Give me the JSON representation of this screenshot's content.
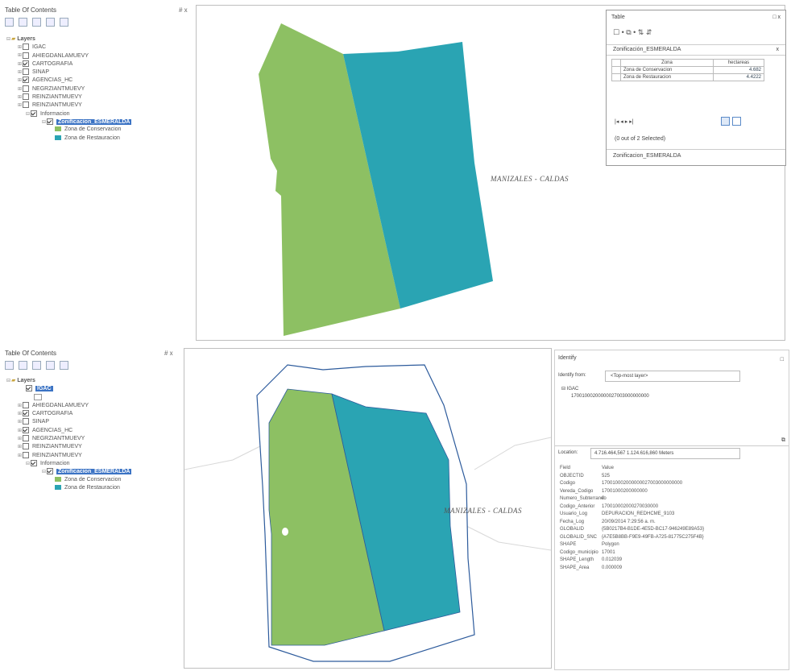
{
  "top": {
    "toc": {
      "title": "Table Of Contents",
      "pin": "# x",
      "layers_root": "Layers",
      "items": [
        {
          "label": "IGAC",
          "checked": false
        },
        {
          "label": "AHIEGDANLAMUEVY",
          "checked": false
        },
        {
          "label": "CARTOGRAFIA",
          "checked": true
        },
        {
          "label": "SINAP",
          "checked": false
        },
        {
          "label": "AGENCIAS_HC",
          "checked": true
        },
        {
          "label": "NEGRZIANTMUEVY",
          "checked": false
        },
        {
          "label": "REINZIANTMUEVY",
          "checked": false
        },
        {
          "label": "REINZIANTMUEVY",
          "checked": false
        },
        {
          "label": "Informacion",
          "checked": true
        }
      ],
      "selected_layer": "Zonificacion_ESMERALDA",
      "legend": [
        {
          "label": "Zona de Conservacion",
          "color": "#8dc063"
        },
        {
          "label": "Zona de Restauracion",
          "color": "#2aa4b3"
        }
      ]
    },
    "map_label": "MANIZALES - CALDAS",
    "table": {
      "title": "Table",
      "window_controls": "□ x",
      "toolbar": "☐ •  ⧉ •  ⇅ ⇵",
      "layer_name": "Zonificación_ESMERALDA",
      "close": "x",
      "columns": [
        "Zona",
        "hectareas"
      ],
      "rows": [
        {
          "zona": "Zona de Conservacion",
          "hectareas": "4.682"
        },
        {
          "zona": "Zona de Restauracion",
          "hectareas": "4.4222"
        }
      ],
      "nav": "|◂  ◂      ▸  ▸|",
      "selection_status": "(0 out of 2 Selected)",
      "footer_tab": "Zonificacion_ESMERALDA"
    }
  },
  "bottom": {
    "toc": {
      "title": "Table Of Contents",
      "pin": "# x",
      "layers_root": "Layers",
      "igac": "IGAC",
      "items": [
        {
          "label": "AHIEGDANLAMUEVY",
          "checked": false
        },
        {
          "label": "CARTOGRAFIA",
          "checked": true
        },
        {
          "label": "SINAP",
          "checked": false
        },
        {
          "label": "AGENCIAS_HC",
          "checked": true
        },
        {
          "label": "NEGRZIANTMUEVY",
          "checked": false
        },
        {
          "label": "REINZIANTMUEVY",
          "checked": false
        },
        {
          "label": "REINZIANTMUEVY",
          "checked": false
        },
        {
          "label": "Informacion",
          "checked": true
        }
      ],
      "selected_layer": "Zonificacion_ESMERALDA",
      "legend": [
        {
          "label": "Zona de Conservacion",
          "color": "#8dc063"
        },
        {
          "label": "Zona de Restauracion",
          "color": "#2aa4b3"
        }
      ]
    },
    "map_label": "MANIZALES - CALDAS",
    "identify": {
      "title": "Identify",
      "window_control": "□",
      "identify_from_label": "Identify from:",
      "identify_from_value": "<Top-most layer>",
      "tree_root": "IGAC",
      "tree_child": "17001000200000027003000000000",
      "location_label": "Location:",
      "location_value": "4.716.464,567  1.124.616,860 Meters",
      "field_header": "Field",
      "value_header": "Value",
      "fields": [
        {
          "k": "OBJECTID",
          "v": "525"
        },
        {
          "k": "Codigo",
          "v": "170010002000000027003000000000"
        },
        {
          "k": "Vereda_Codigo",
          "v": "17001000200000000"
        },
        {
          "k": "Numero_Subterraneo",
          "v": "0"
        },
        {
          "k": "Codigo_Anterior",
          "v": "170010002000270030000"
        },
        {
          "k": "Usuario_Log",
          "v": "DEPURACION_REDHCME_9103"
        },
        {
          "k": "Fecha_Log",
          "v": "20/09/2014 7:29:56 a. m."
        },
        {
          "k": "GLOBALID",
          "v": "{5B0217B4-B1DE-4E5D-BC17-946249E89A53}"
        },
        {
          "k": "GLOBALID_SNC",
          "v": "{A7E5B8BB-F9E9-49FB-A725-81775C275F4B}"
        },
        {
          "k": "SHAPE",
          "v": "Polygon"
        },
        {
          "k": "Codigo_municipio",
          "v": "17001"
        },
        {
          "k": "SHAPE_Length",
          "v": "0.012039"
        },
        {
          "k": "SHAPE_Area",
          "v": "0.000009"
        }
      ]
    }
  },
  "colors": {
    "conservacion": "#8dc063",
    "restauracion": "#2aa4b3",
    "selection": "#3b73c4"
  }
}
